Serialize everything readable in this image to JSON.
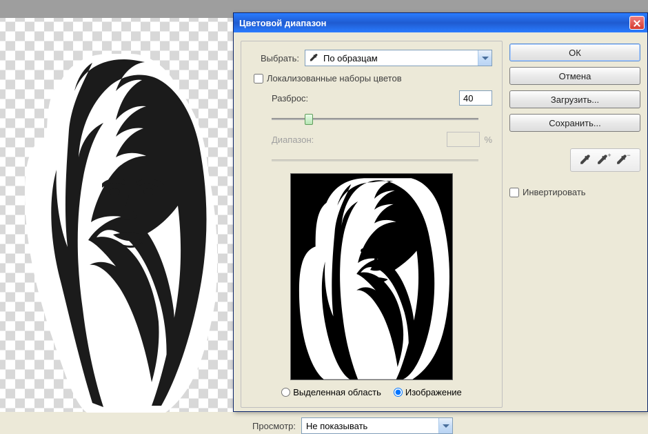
{
  "dialog": {
    "title": "Цветовой диапазон",
    "select_label": "Выбрать:",
    "select_value": "По образцам",
    "localized_checkbox": "Локализованные наборы цветов",
    "localized_checked": false,
    "fuzziness_label": "Разброс:",
    "fuzziness_value": "40",
    "fuzziness_slider_percent": 18,
    "range_label": "Диапазон:",
    "range_value": "",
    "range_unit": "%",
    "radio_selection": "Выделенная область",
    "radio_image": "Изображение",
    "radio_checked": "image",
    "preview_label": "Просмотр:",
    "preview_value": "Не показывать",
    "buttons": {
      "ok": "ОК",
      "cancel": "Отмена",
      "load": "Загрузить...",
      "save": "Сохранить..."
    },
    "invert_label": "Инвертировать",
    "invert_checked": false
  }
}
